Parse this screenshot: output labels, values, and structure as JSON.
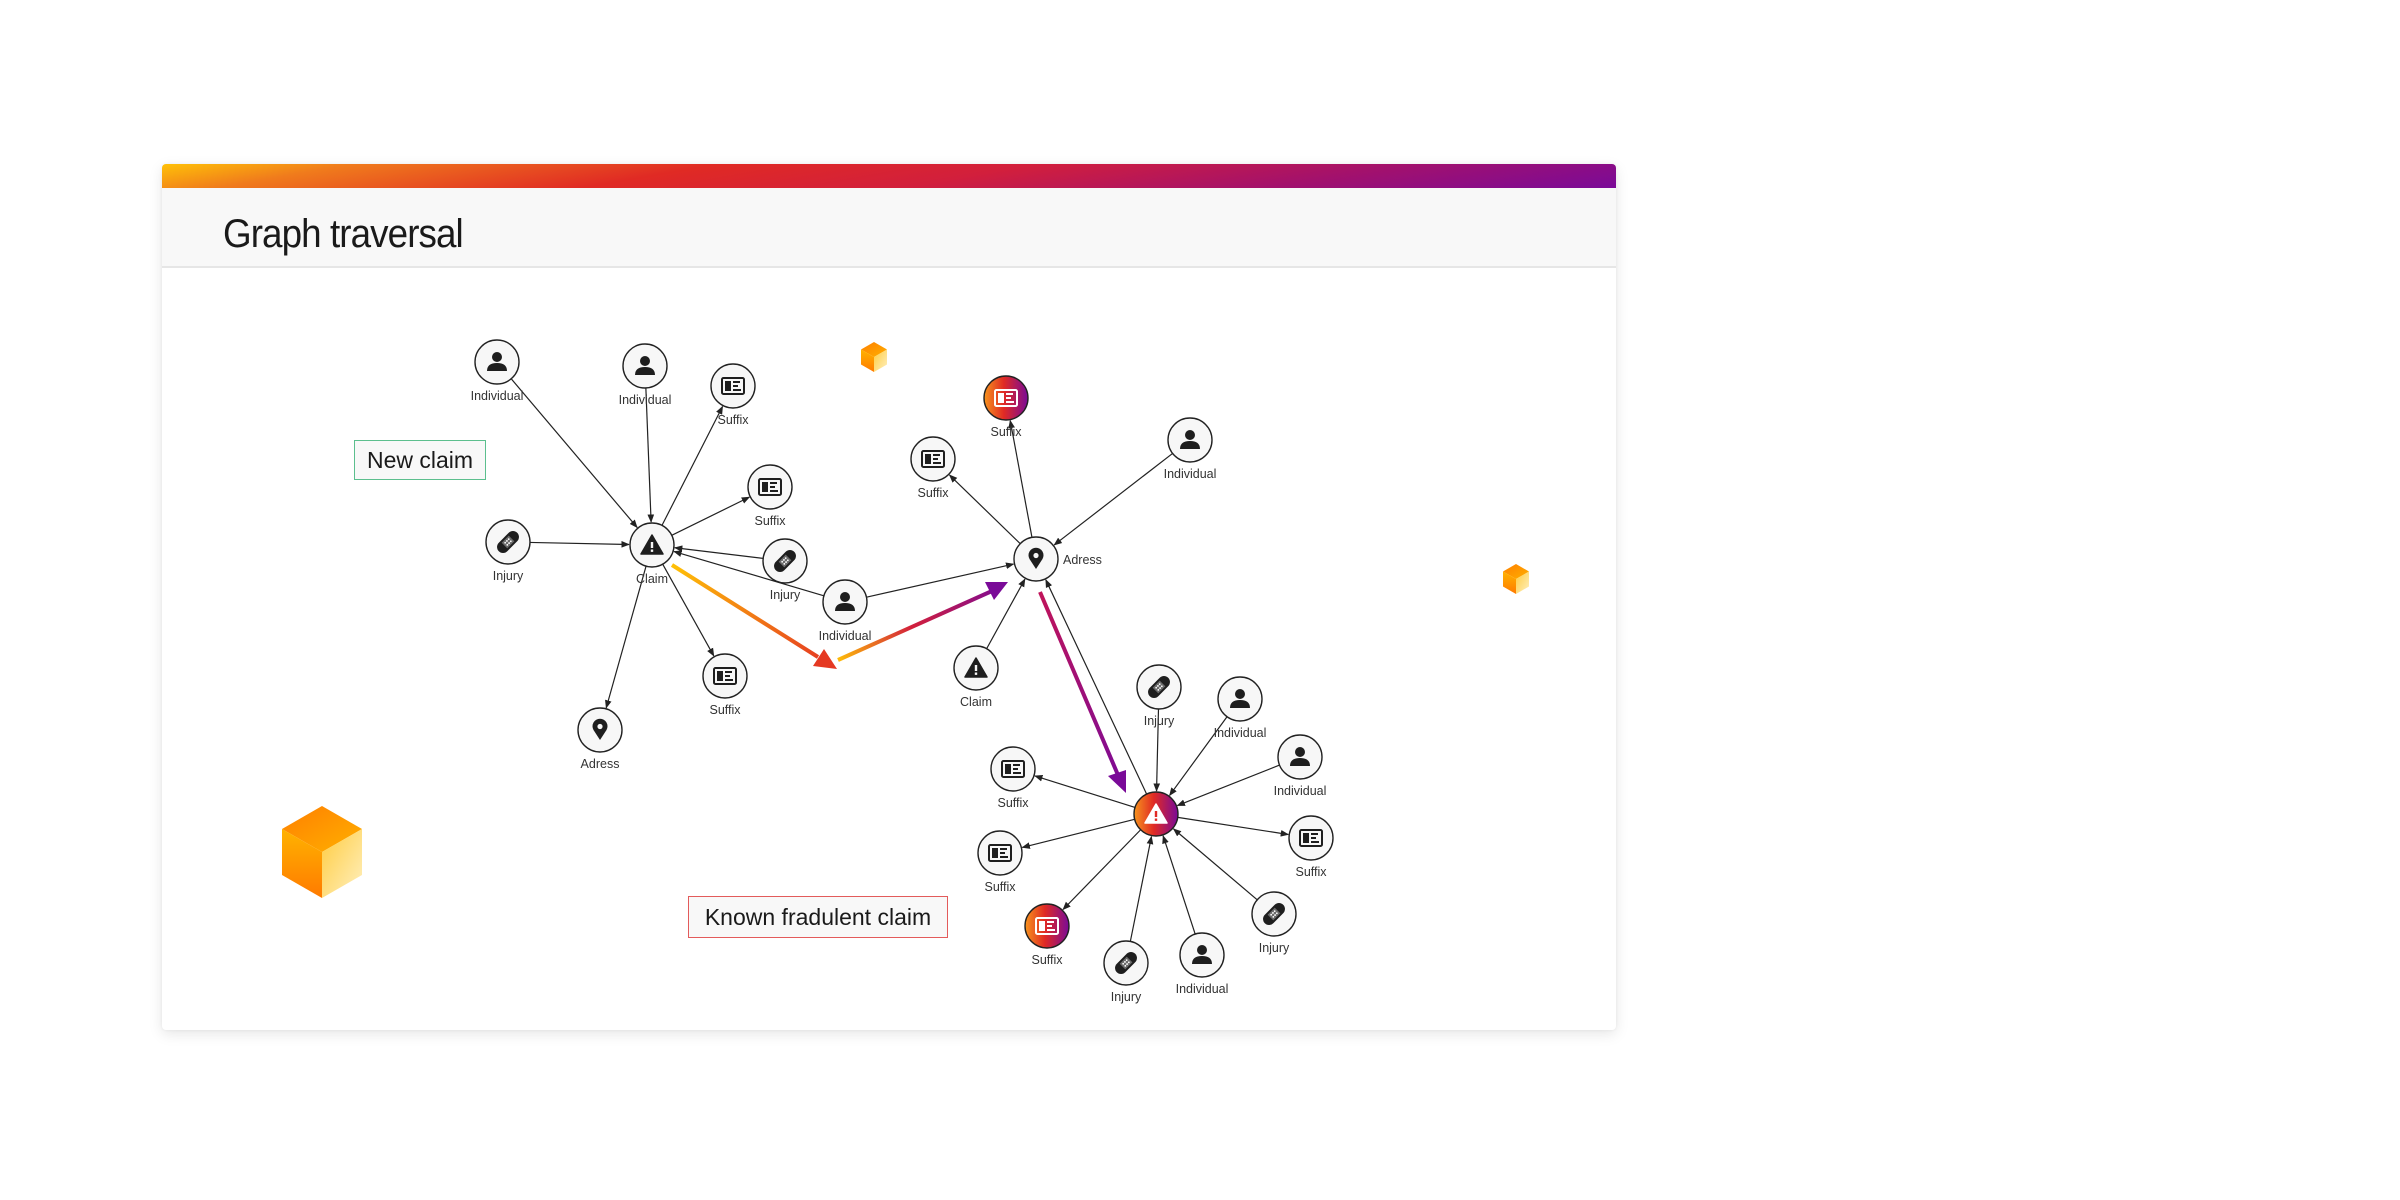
{
  "slide": {
    "title": "Graph traversal",
    "gradient_colors": [
      "#ffc107",
      "#e02a24",
      "#7a0a98"
    ]
  },
  "callouts": {
    "new_claim": "New claim",
    "known_claim": "Known fradulent claim"
  },
  "graph": {
    "node_types": {
      "Individual": "person-icon",
      "Suffix": "id-card-icon",
      "Injury": "bandage-icon",
      "Claim": "warning-icon",
      "Adress": "location-pin-icon"
    },
    "nodes": [
      {
        "id": "c1",
        "type": "Claim",
        "label": "Claim",
        "highlight": false
      },
      {
        "id": "i1",
        "type": "Individual",
        "label": "Individual",
        "highlight": false
      },
      {
        "id": "i2",
        "type": "Individual",
        "label": "Individual",
        "highlight": false
      },
      {
        "id": "s1",
        "type": "Suffix",
        "label": "Suffix",
        "highlight": false
      },
      {
        "id": "s2",
        "type": "Suffix",
        "label": "Suffix",
        "highlight": false
      },
      {
        "id": "j1",
        "type": "Injury",
        "label": "Injury",
        "highlight": false
      },
      {
        "id": "j2",
        "type": "Injury",
        "label": "Injury",
        "highlight": false
      },
      {
        "id": "i3",
        "type": "Individual",
        "label": "Individual",
        "highlight": false
      },
      {
        "id": "s3",
        "type": "Suffix",
        "label": "Suffix",
        "highlight": false
      },
      {
        "id": "a1",
        "type": "Adress",
        "label": "Adress",
        "highlight": false
      },
      {
        "id": "a2",
        "type": "Adress",
        "label": "Adress",
        "highlight": false
      },
      {
        "id": "s4",
        "type": "Suffix",
        "label": "Suffix",
        "highlight": true
      },
      {
        "id": "s5",
        "type": "Suffix",
        "label": "Suffix",
        "highlight": false
      },
      {
        "id": "i4",
        "type": "Individual",
        "label": "Individual",
        "highlight": false
      },
      {
        "id": "c2",
        "type": "Claim",
        "label": "Claim",
        "highlight": false
      },
      {
        "id": "k1",
        "type": "Claim",
        "label": "",
        "highlight": true
      },
      {
        "id": "j3",
        "type": "Injury",
        "label": "Injury",
        "highlight": false
      },
      {
        "id": "i5",
        "type": "Individual",
        "label": "Individual",
        "highlight": false
      },
      {
        "id": "i6",
        "type": "Individual",
        "label": "Individual",
        "highlight": false
      },
      {
        "id": "s6",
        "type": "Suffix",
        "label": "Suffix",
        "highlight": false
      },
      {
        "id": "s7",
        "type": "Suffix",
        "label": "Suffix",
        "highlight": false
      },
      {
        "id": "s8",
        "type": "Suffix",
        "label": "Suffix",
        "highlight": false
      },
      {
        "id": "j4",
        "type": "Injury",
        "label": "Injury",
        "highlight": false
      },
      {
        "id": "i7",
        "type": "Individual",
        "label": "Individual",
        "highlight": false
      },
      {
        "id": "j5",
        "type": "Injury",
        "label": "Injury",
        "highlight": false
      },
      {
        "id": "s9",
        "type": "Suffix",
        "label": "Suffix",
        "highlight": true
      }
    ],
    "edges": [
      {
        "from": "i1",
        "to": "c1"
      },
      {
        "from": "i2",
        "to": "c1"
      },
      {
        "from": "c1",
        "to": "s1"
      },
      {
        "from": "c1",
        "to": "s2"
      },
      {
        "from": "j1",
        "to": "c1"
      },
      {
        "from": "j2",
        "to": "c1"
      },
      {
        "from": "i3",
        "to": "c1"
      },
      {
        "from": "c1",
        "to": "s3"
      },
      {
        "from": "c1",
        "to": "a1"
      },
      {
        "from": "i3",
        "to": "a2"
      },
      {
        "from": "a2",
        "to": "s4"
      },
      {
        "from": "a2",
        "to": "s5"
      },
      {
        "from": "i4",
        "to": "a2"
      },
      {
        "from": "c2",
        "to": "a2"
      },
      {
        "from": "k1",
        "to": "a2"
      },
      {
        "from": "j3",
        "to": "k1"
      },
      {
        "from": "i5",
        "to": "k1"
      },
      {
        "from": "i6",
        "to": "k1"
      },
      {
        "from": "k1",
        "to": "s6"
      },
      {
        "from": "k1",
        "to": "s7"
      },
      {
        "from": "k1",
        "to": "s8"
      },
      {
        "from": "j4",
        "to": "k1"
      },
      {
        "from": "i7",
        "to": "k1"
      },
      {
        "from": "j5",
        "to": "k1"
      },
      {
        "from": "k1",
        "to": "s9"
      }
    ],
    "traversal_path": [
      "c1",
      "i3",
      "a2",
      "k1"
    ]
  }
}
